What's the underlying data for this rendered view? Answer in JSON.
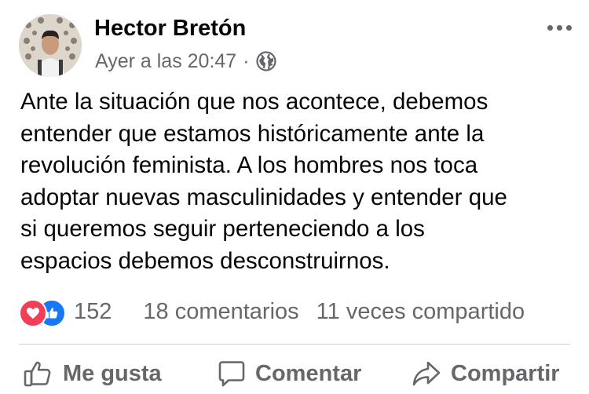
{
  "post": {
    "author": "Hector Bretón",
    "timestamp": "Ayer a las 20:47",
    "separator": "·",
    "privacy_icon": "globe-icon",
    "menu_icon": "more-options-icon",
    "text_lines": [
      "Ante la situación que nos acontece, debemos",
      "entender que estamos históricamente ante la",
      "revolución feminista. A los hombres nos toca",
      "adoptar nuevas masculinidades y entender que",
      "si queremos seguir perteneciendo a los",
      "espacios debemos desconstruirnos."
    ]
  },
  "stats": {
    "reaction_icons": [
      "love-reaction-icon",
      "like-reaction-icon"
    ],
    "reaction_count": "152",
    "comments": "18 comentarios",
    "shares": "11 veces compartido"
  },
  "actions": {
    "like": "Me gusta",
    "comment": "Comentar",
    "share": "Compartir"
  },
  "colors": {
    "text": "#050505",
    "secondary": "#65676b",
    "like_blue": "#1877f2",
    "love_red": "#f33e58",
    "divider": "#ced0d4"
  }
}
